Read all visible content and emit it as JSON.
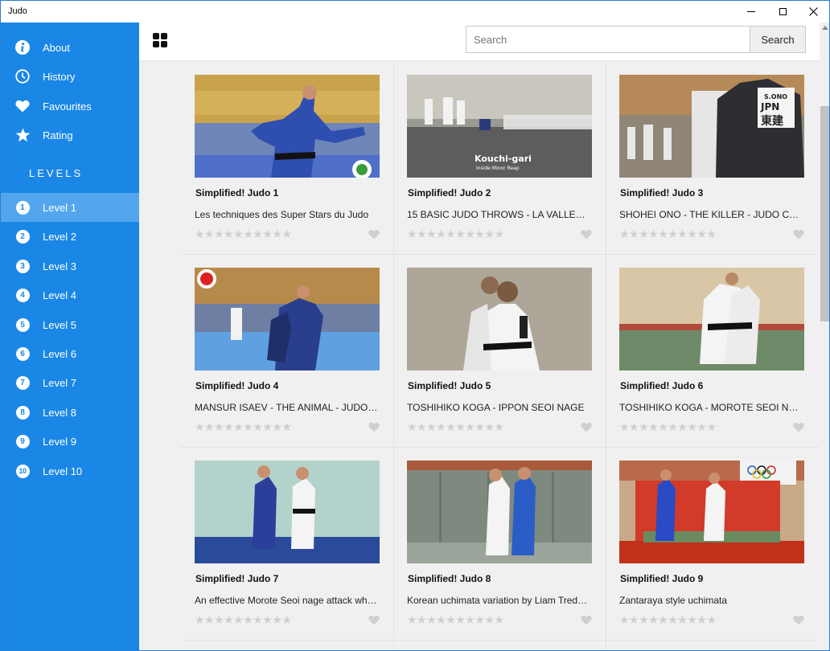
{
  "window": {
    "title": "Judo"
  },
  "sidebar": {
    "nav": [
      {
        "label": "About",
        "icon": "info-icon"
      },
      {
        "label": "History",
        "icon": "clock-icon"
      },
      {
        "label": "Favourites",
        "icon": "heart-icon"
      },
      {
        "label": "Rating",
        "icon": "star-icon"
      }
    ],
    "levels_header": "LEVELS",
    "levels": [
      {
        "number": "1",
        "label": "Level 1",
        "active": true
      },
      {
        "number": "2",
        "label": "Level 2"
      },
      {
        "number": "3",
        "label": "Level 3"
      },
      {
        "number": "4",
        "label": "Level 4"
      },
      {
        "number": "5",
        "label": "Level 5"
      },
      {
        "number": "6",
        "label": "Level 6"
      },
      {
        "number": "7",
        "label": "Level 7"
      },
      {
        "number": "8",
        "label": "Level 8"
      },
      {
        "number": "9",
        "label": "Level 9"
      },
      {
        "number": "10",
        "label": "Level 10"
      }
    ]
  },
  "toolbar": {
    "search_placeholder": "Search",
    "search_button": "Search"
  },
  "videos": [
    {
      "title": "Simplified! Judo 1",
      "subtitle": "Les techniques des Super Stars du Judo",
      "rating": 0,
      "favourite": false,
      "thumb_caption": ""
    },
    {
      "title": "Simplified! Judo 2",
      "subtitle": "15 BASIC JUDO THROWS - LA VALLE…",
      "rating": 0,
      "favourite": false,
      "thumb_caption": "Kouchi-gari",
      "thumb_caption_sub": "Inside Minor Reap"
    },
    {
      "title": "Simplified! Judo 3",
      "subtitle": "SHOHEI ONO - THE KILLER - JUDO C…",
      "rating": 0,
      "favourite": false,
      "thumb_caption": "",
      "thumb_back_name": "S.ONO",
      "thumb_back_country": "JPN",
      "thumb_back_kanji": "東建"
    },
    {
      "title": "Simplified! Judo 4",
      "subtitle": "MANSUR ISAEV - THE ANIMAL - JUDO…",
      "rating": 0,
      "favourite": false,
      "thumb_caption": ""
    },
    {
      "title": "Simplified! Judo 5",
      "subtitle": "TOSHIHIKO KOGA - IPPON SEOI NAGE",
      "rating": 0,
      "favourite": false,
      "thumb_caption": ""
    },
    {
      "title": "Simplified! Judo 6",
      "subtitle": "TOSHIHIKO KOGA - MOROTE SEOI N…",
      "rating": 0,
      "favourite": false,
      "thumb_caption": ""
    },
    {
      "title": "Simplified! Judo 7",
      "subtitle": "An effective Morote Seoi nage attack wh…",
      "rating": 0,
      "favourite": false,
      "thumb_caption": ""
    },
    {
      "title": "Simplified! Judo 8",
      "subtitle": "Korean uchimata variation by Liam Tred…",
      "rating": 0,
      "favourite": false,
      "thumb_caption": ""
    },
    {
      "title": "Simplified! Judo 9",
      "subtitle": "Zantaraya style uchimata",
      "rating": 0,
      "favourite": false,
      "thumb_caption": ""
    }
  ],
  "rating_max": 10,
  "colors": {
    "sidebar": "#1a87e6",
    "sidebar_active": "#53a6ee",
    "content_bg": "#f0f0f0",
    "star_empty": "#cfcfcf"
  }
}
